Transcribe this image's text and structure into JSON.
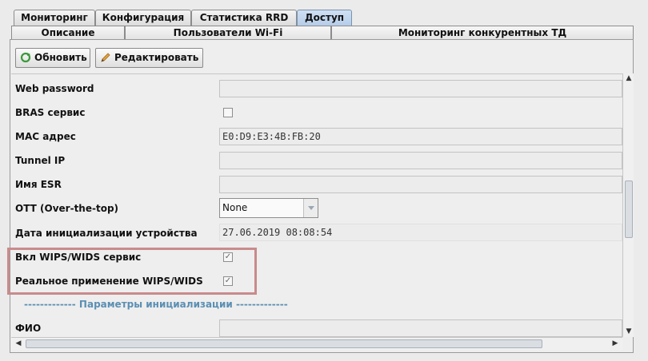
{
  "tabs": [
    "Мониторинг",
    "Конфигурация",
    "Статистика RRD",
    "Доступ"
  ],
  "subtabs": [
    "Описание",
    "Пользователи Wi-Fi",
    "Мониторинг конкурентных ТД"
  ],
  "toolbar": {
    "refresh_label": "Обновить",
    "edit_label": "Редактировать"
  },
  "rows": {
    "web_password": {
      "label": "Web password",
      "value": ""
    },
    "bras": {
      "label": "BRAS сервис",
      "checked": false
    },
    "mac": {
      "label": "MAC адрес",
      "value": "E0:D9:E3:4B:FB:20"
    },
    "tunnel": {
      "label": "Tunnel IP",
      "value": ""
    },
    "esr": {
      "label": "Имя ESR",
      "value": ""
    },
    "ott": {
      "label": "OTT (Over-the-top)",
      "value": "None"
    },
    "init_date": {
      "label": "Дата инициализации устройства",
      "value": "27.06.2019 08:08:54"
    },
    "wips": {
      "label": "Вкл WIPS/WIDS сервис",
      "checked": true,
      "mark": "✓"
    },
    "wips_real": {
      "label": "Реальное применение WIPS/WIDS",
      "checked": true,
      "mark": "✓"
    },
    "section": "------------- Параметры инициализации -------------",
    "fio": {
      "label": "ФИО",
      "value": ""
    }
  },
  "colors": {
    "highlight": "#c98b8b",
    "section_text": "#5b8fb3",
    "active_tab": "#b6cde8"
  }
}
